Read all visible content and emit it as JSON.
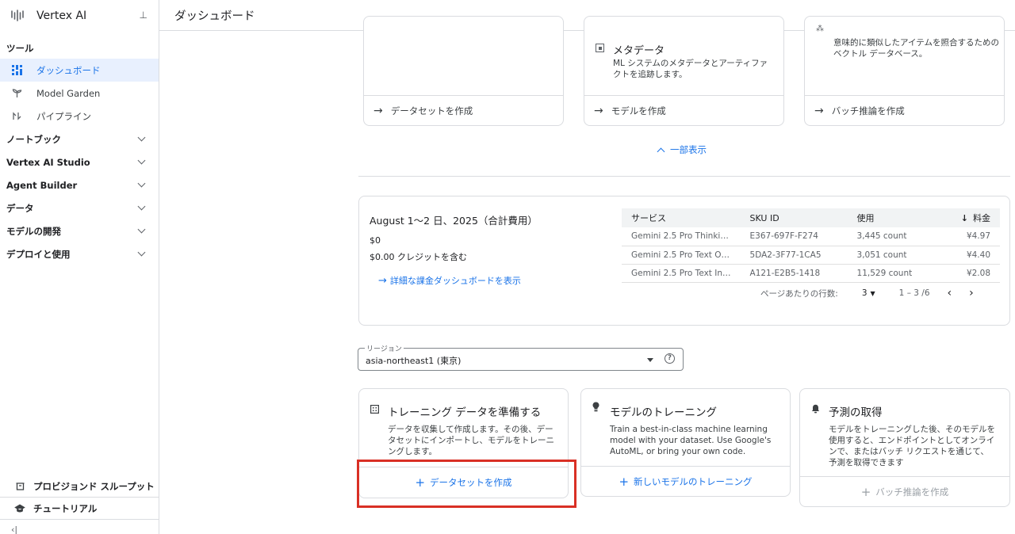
{
  "app": {
    "name": "Vertex AI"
  },
  "sidebar": {
    "section_tools": "ツール",
    "tools": [
      {
        "label": "ダッシュボード",
        "icon": "dashboard-icon",
        "active": true
      },
      {
        "label": "Model Garden",
        "icon": "model-garden-icon"
      },
      {
        "label": "パイプライン",
        "icon": "pipeline-icon"
      }
    ],
    "groups": [
      "ノートブック",
      "Vertex AI Studio",
      "Agent Builder",
      "データ",
      "モデルの開発",
      "デプロイと使用"
    ],
    "bottom": [
      {
        "label": "プロビジョンド スループット",
        "icon": "throughput-icon"
      },
      {
        "label": "チュートリアル",
        "icon": "school-icon"
      }
    ]
  },
  "topbar": {
    "title": "ダッシュボード"
  },
  "top_cards": [
    {
      "title": "",
      "desc": "",
      "action": "データセットを作成"
    },
    {
      "title": "メタデータ",
      "desc": "ML システムのメタデータとアーティファクトを追跡します。",
      "action": "モデルを作成"
    },
    {
      "title": "",
      "desc": "意味的に類似したアイテムを照合するためのベクトル データベース。",
      "action": "バッチ推論を作成"
    }
  ],
  "show_less": "一部表示",
  "billing": {
    "title": "August 1〜2 日、2025（合計費用）",
    "cost": "$0",
    "credit": "$0.00 クレジットを含む",
    "link": "詳細な課金ダッシュボードを表示",
    "columns": [
      "サービス",
      "SKU ID",
      "使用",
      "料金"
    ],
    "rows": [
      [
        "Gemini 2.5 Pro Thinki…",
        "E367-697F-F274",
        "3,445 count",
        "¥4.97"
      ],
      [
        "Gemini 2.5 Pro Text O…",
        "5DA2-3F77-1CA5",
        "3,051 count",
        "¥4.40"
      ],
      [
        "Gemini 2.5 Pro Text In…",
        "A121-E2B5-1418",
        "11,529 count",
        "¥2.08"
      ]
    ],
    "pager": {
      "rows_label": "ページあたりの行数:",
      "rows_value": "3",
      "range": "1 – 3 /6"
    }
  },
  "region": {
    "label": "リージョン",
    "value": "asia-northeast1 (東京)"
  },
  "bottom_cards": [
    {
      "title": "トレーニング データを準備する",
      "desc": "データを収集して作成します。その後、データセットにインポートし、モデルをトレーニングします。",
      "action": "データセットを作成"
    },
    {
      "title": "モデルのトレーニング",
      "desc": "Train a best-in-class machine learning model with your dataset. Use Google's AutoML, or bring your own code.",
      "action": "新しいモデルのトレーニング"
    },
    {
      "title": "予測の取得",
      "desc": "モデルをトレーニングした後、そのモデルを使用すると、エンドポイントとしてオンラインで、またはバッチ リクエストを通じて、予測を取得できます",
      "action": "バッチ推論を作成"
    }
  ],
  "colors": {
    "accent": "#1a73e8",
    "highlight": "#d93025",
    "active_bg": "#e8f0fe"
  }
}
